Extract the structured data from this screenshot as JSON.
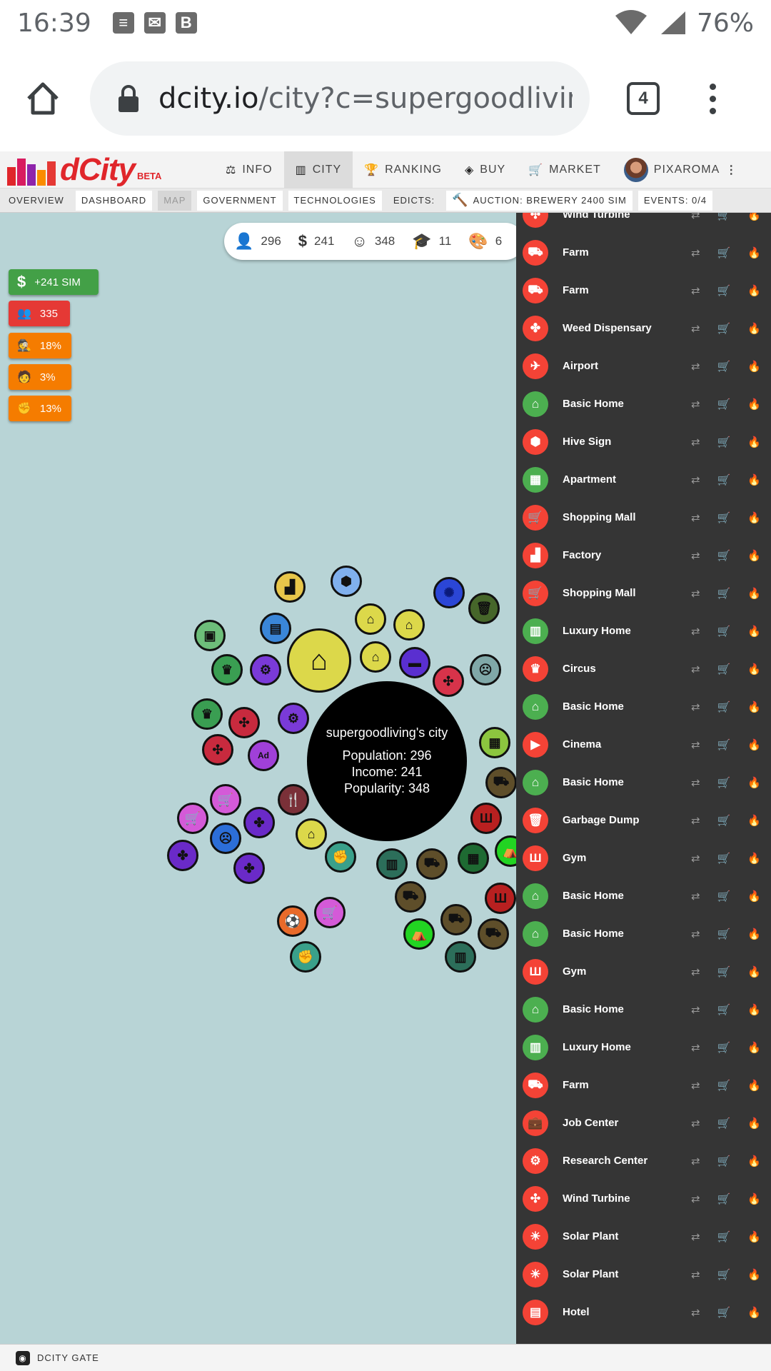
{
  "status_bar": {
    "time": "16:39",
    "battery": "76%",
    "notif_icons": [
      "notes-icon",
      "mail-icon",
      "b-app-icon"
    ],
    "notif_b_letter": "B"
  },
  "browser": {
    "url_host": "dcity.io",
    "url_path": "/city?c=supergoodliving",
    "tab_count": "4"
  },
  "navbar": {
    "brand_main": "dCity",
    "brand_beta": "BETA",
    "items": [
      {
        "label": "INFO",
        "icon": "scales-icon",
        "glyph": "⚖"
      },
      {
        "label": "CITY",
        "icon": "city-icon",
        "glyph": "▥"
      },
      {
        "label": "RANKING",
        "icon": "trophy-icon",
        "glyph": "🏆"
      },
      {
        "label": "BUY",
        "icon": "layers-icon",
        "glyph": "◈"
      },
      {
        "label": "MARKET",
        "icon": "cart-icon",
        "glyph": "🛒"
      }
    ],
    "user": "PIXAROMA"
  },
  "subbar": {
    "overview": "OVERVIEW",
    "dashboard": "DASHBOARD",
    "map": "MAP",
    "government": "GOVERNMENT",
    "technologies": "TECHNOLOGIES",
    "edicts": "EDICTS:",
    "auction": "AUCTION: BREWERY 2400 SIM",
    "events": "EVENTS: 0/4"
  },
  "stats": [
    {
      "icon": "person-icon",
      "glyph": "👤",
      "value": "296"
    },
    {
      "icon": "dollar-icon",
      "glyph": "$",
      "value": "241"
    },
    {
      "icon": "smile-icon",
      "glyph": "☺",
      "value": "348"
    },
    {
      "icon": "graduation-cap-icon",
      "glyph": "🎓",
      "value": "11"
    },
    {
      "icon": "palette-icon",
      "glyph": "🎨",
      "value": "6"
    }
  ],
  "badges": [
    {
      "icon": "dollar-icon",
      "glyph": "$",
      "text": "+241 SIM",
      "color": "#43a047"
    },
    {
      "icon": "users-icon",
      "glyph": "👥",
      "text": "335",
      "color": "#e53935"
    },
    {
      "icon": "detective-icon",
      "glyph": "🕵",
      "text": "18%",
      "color": "#f57c00"
    },
    {
      "icon": "teacher-icon",
      "glyph": "🧑",
      "text": "3%",
      "color": "#f57c00"
    },
    {
      "icon": "fist-icon",
      "glyph": "✊",
      "text": "13%",
      "color": "#f57c00"
    }
  ],
  "city": {
    "name": "supergoodliving's city",
    "population": "Population: 296",
    "income": "Income: 241",
    "popularity": "Popularity: 348"
  },
  "buildings": [
    {
      "name": "Wind Turbine",
      "color": "red",
      "icon": "fan-icon",
      "glyph": "✣"
    },
    {
      "name": "Farm",
      "color": "red",
      "icon": "tractor-icon",
      "glyph": "⛟"
    },
    {
      "name": "Farm",
      "color": "red",
      "icon": "tractor-icon",
      "glyph": "⛟"
    },
    {
      "name": "Weed Dispensary",
      "color": "red",
      "icon": "leaf-icon",
      "glyph": "✤"
    },
    {
      "name": "Airport",
      "color": "red",
      "icon": "plane-icon",
      "glyph": "✈"
    },
    {
      "name": "Basic Home",
      "color": "green",
      "icon": "home-icon",
      "glyph": "⌂"
    },
    {
      "name": "Hive Sign",
      "color": "red",
      "icon": "cube-icon",
      "glyph": "⬢"
    },
    {
      "name": "Apartment",
      "color": "green",
      "icon": "building-icon",
      "glyph": "▦"
    },
    {
      "name": "Shopping Mall",
      "color": "red",
      "icon": "cart-icon",
      "glyph": "🛒"
    },
    {
      "name": "Factory",
      "color": "red",
      "icon": "factory-icon",
      "glyph": "▟"
    },
    {
      "name": "Shopping Mall",
      "color": "red",
      "icon": "cart-icon",
      "glyph": "🛒"
    },
    {
      "name": "Luxury Home",
      "color": "green",
      "icon": "city-icon",
      "glyph": "▥"
    },
    {
      "name": "Circus",
      "color": "red",
      "icon": "crown-icon",
      "glyph": "♛"
    },
    {
      "name": "Basic Home",
      "color": "green",
      "icon": "home-icon",
      "glyph": "⌂"
    },
    {
      "name": "Cinema",
      "color": "red",
      "icon": "video-icon",
      "glyph": "▶"
    },
    {
      "name": "Basic Home",
      "color": "green",
      "icon": "home-icon",
      "glyph": "⌂"
    },
    {
      "name": "Garbage Dump",
      "color": "red",
      "icon": "trash-icon",
      "glyph": "🗑"
    },
    {
      "name": "Gym",
      "color": "red",
      "icon": "dumbbell-icon",
      "glyph": "Ш"
    },
    {
      "name": "Basic Home",
      "color": "green",
      "icon": "home-icon",
      "glyph": "⌂"
    },
    {
      "name": "Basic Home",
      "color": "green",
      "icon": "home-icon",
      "glyph": "⌂"
    },
    {
      "name": "Gym",
      "color": "red",
      "icon": "dumbbell-icon",
      "glyph": "Ш"
    },
    {
      "name": "Basic Home",
      "color": "green",
      "icon": "home-icon",
      "glyph": "⌂"
    },
    {
      "name": "Luxury Home",
      "color": "green",
      "icon": "city-icon",
      "glyph": "▥"
    },
    {
      "name": "Farm",
      "color": "red",
      "icon": "tractor-icon",
      "glyph": "⛟"
    },
    {
      "name": "Job Center",
      "color": "red",
      "icon": "briefcase-icon",
      "glyph": "💼"
    },
    {
      "name": "Research Center",
      "color": "red",
      "icon": "gear-icon",
      "glyph": "⚙"
    },
    {
      "name": "Wind Turbine",
      "color": "red",
      "icon": "fan-icon",
      "glyph": "✣"
    },
    {
      "name": "Solar Plant",
      "color": "red",
      "icon": "sun-icon",
      "glyph": "☀"
    },
    {
      "name": "Solar Plant",
      "color": "red",
      "icon": "sun-icon",
      "glyph": "☀"
    },
    {
      "name": "Hotel",
      "color": "red",
      "icon": "hotel-icon",
      "glyph": "▤"
    }
  ],
  "row_actions": {
    "transfer": "⇄",
    "sell": "🛒",
    "burn": "🔥"
  },
  "footer": {
    "gate": "DCITY GATE"
  }
}
